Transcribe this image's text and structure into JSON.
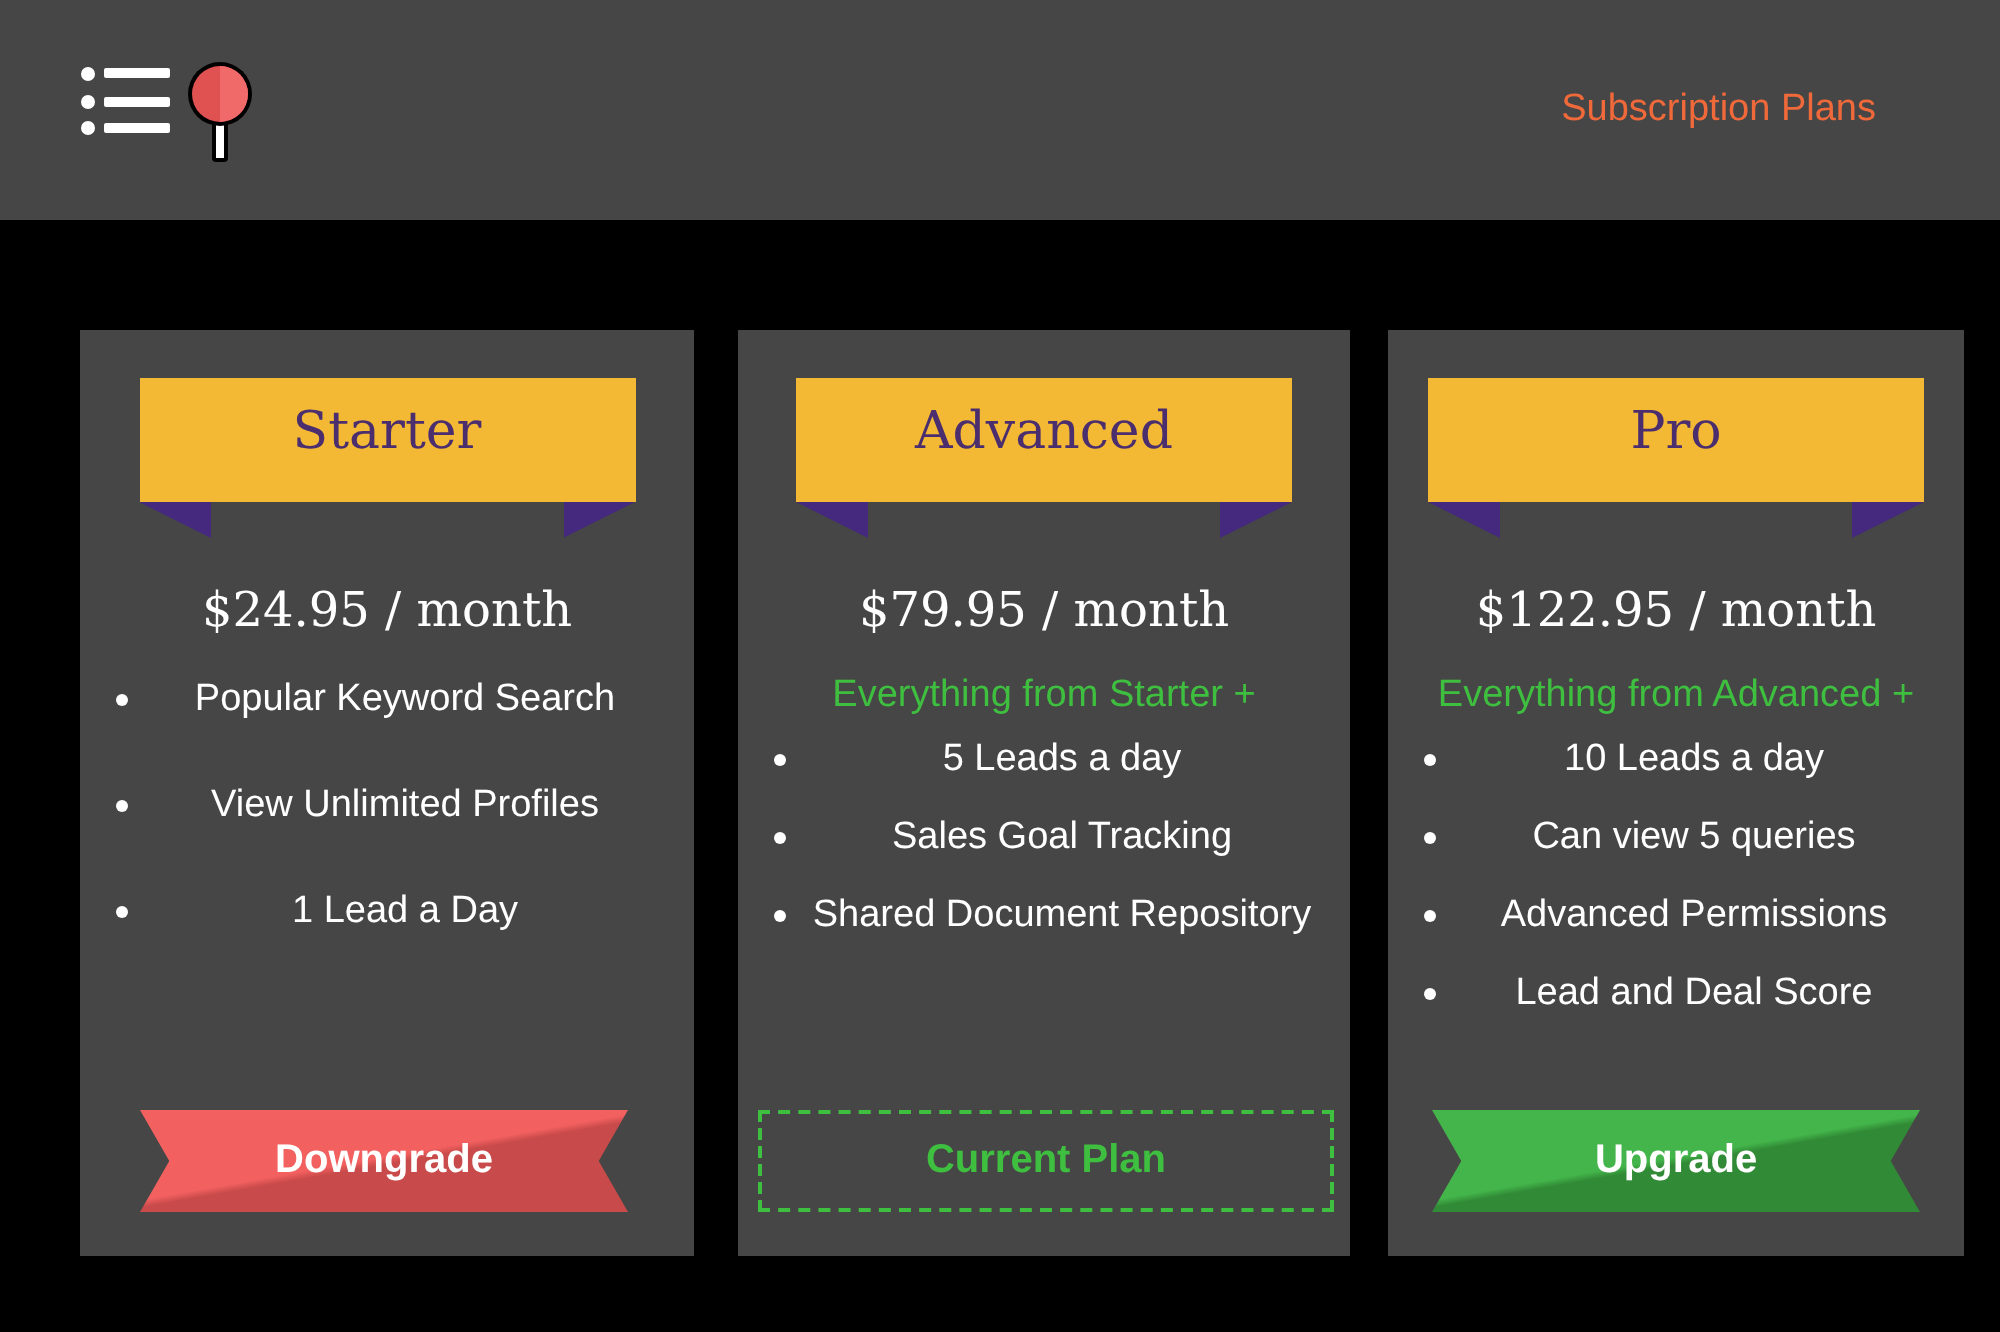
{
  "header": {
    "title": "Subscription Plans"
  },
  "plans": [
    {
      "name": "Starter",
      "price": "$24.95 / month",
      "features": [
        "Popular Keyword Search",
        "View Unlimited Profiles",
        "1 Lead a Day"
      ],
      "action": {
        "kind": "downgrade",
        "label": "Downgrade"
      }
    },
    {
      "name": "Advanced",
      "price": "$79.95 / month",
      "includes": "Everything from Starter +",
      "features": [
        "5 Leads a day",
        "Sales Goal Tracking",
        "Shared Document Repository"
      ],
      "action": {
        "kind": "current",
        "label": "Current Plan"
      }
    },
    {
      "name": "Pro",
      "price": "$122.95 / month",
      "includes": "Everything from Advanced +",
      "features": [
        "10 Leads a day",
        "Can view 5 queries",
        "Advanced Permissions",
        "Lead and Deal Score"
      ],
      "action": {
        "kind": "upgrade",
        "label": "Upgrade"
      }
    }
  ]
}
